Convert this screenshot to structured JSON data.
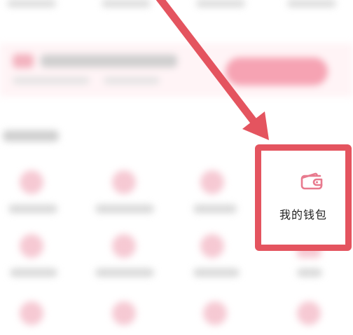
{
  "wallet_tile": {
    "label": "我的钱包",
    "icon": "wallet-icon"
  },
  "colors": {
    "highlight": "#e4545f",
    "arrow": "#e4545f",
    "accent_pink": "#f08aa0",
    "icon_pink": "#e87a8e"
  }
}
